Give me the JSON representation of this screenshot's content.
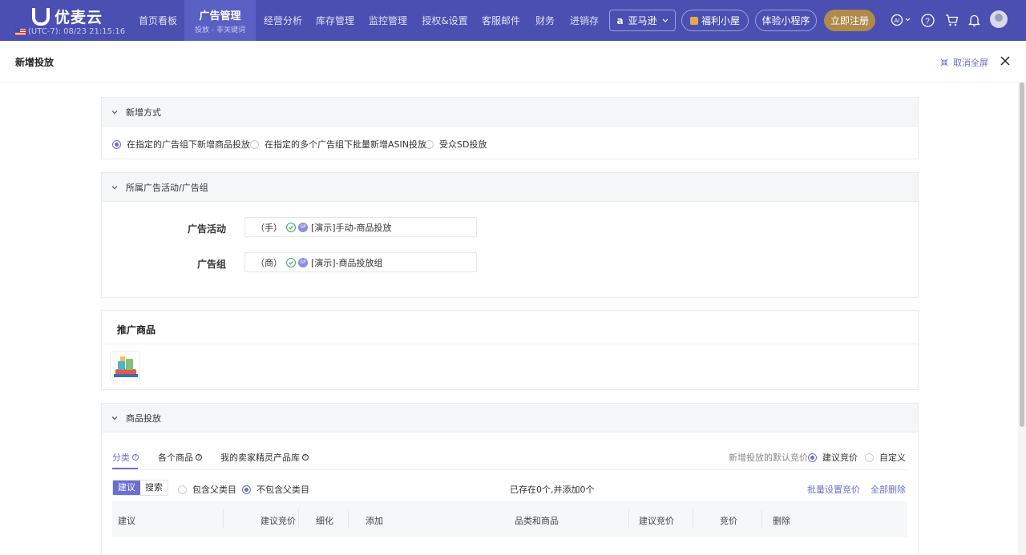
{
  "app": {
    "logo_text": "优麦云",
    "timezone": "(UTC-7): 08/23 21:15:16"
  },
  "nav": {
    "items": [
      {
        "label": "首页看板"
      },
      {
        "label": "广告管理",
        "sub": "投放 - 非关键词"
      },
      {
        "label": "经营分析"
      },
      {
        "label": "库存管理"
      },
      {
        "label": "监控管理"
      },
      {
        "label": "授权&设置"
      },
      {
        "label": "客服邮件"
      },
      {
        "label": "财务"
      },
      {
        "label": "进销存"
      }
    ],
    "store_select": "亚马逊",
    "welfare": "福利小屋",
    "miniapp": "体验小程序",
    "register": "立即注册"
  },
  "drawer": {
    "title": "新增投放",
    "exit_fullscreen": "取消全屏"
  },
  "add_method": {
    "title": "新增方式",
    "options": [
      {
        "label": "在指定的广告组下新增商品投放",
        "selected": true
      },
      {
        "label": "在指定的多个广告组下批量新增ASIN投放",
        "selected": false
      },
      {
        "label": "受众SD投放",
        "selected": false
      }
    ]
  },
  "campaign_group": {
    "title": "所属广告活动/广告组",
    "campaign_label": "广告活动",
    "campaign_prefix": "（手）",
    "campaign_badge": "SP",
    "campaign_value": "[演示]手动-商品投放",
    "group_label": "广告组",
    "group_prefix": "（商）",
    "group_badge": "SP",
    "group_value": "[演示]-商品投放组"
  },
  "promoted": {
    "title": "推广商品"
  },
  "product_targeting": {
    "title": "商品投放",
    "tabs": [
      {
        "label": "分类",
        "active": true
      },
      {
        "label": "各个商品",
        "active": false
      },
      {
        "label": "我的卖家精灵产品库",
        "active": false
      }
    ],
    "default_bid_label": "新增投放的默认竞价",
    "default_bid_options": [
      {
        "label": "建议竞价",
        "selected": true
      },
      {
        "label": "自定义",
        "selected": false
      }
    ],
    "seg_options": [
      "建议",
      "搜索"
    ],
    "parent_options": [
      {
        "label": "包含父类目",
        "selected": false
      },
      {
        "label": "不包含父类目",
        "selected": true
      }
    ],
    "summary": "已存在0个,并添加0个",
    "batch_bid": "批量设置竞价",
    "delete_all": "全部删除",
    "columns": [
      "建议",
      "建议竞价",
      "细化",
      "添加",
      "品类和商品",
      "建议竞价",
      "竞价",
      "删除"
    ]
  },
  "colors": {
    "nav_bg": "#4a4fb1",
    "accent": "#6a6fd0",
    "register_bg": "#b08a4a"
  }
}
